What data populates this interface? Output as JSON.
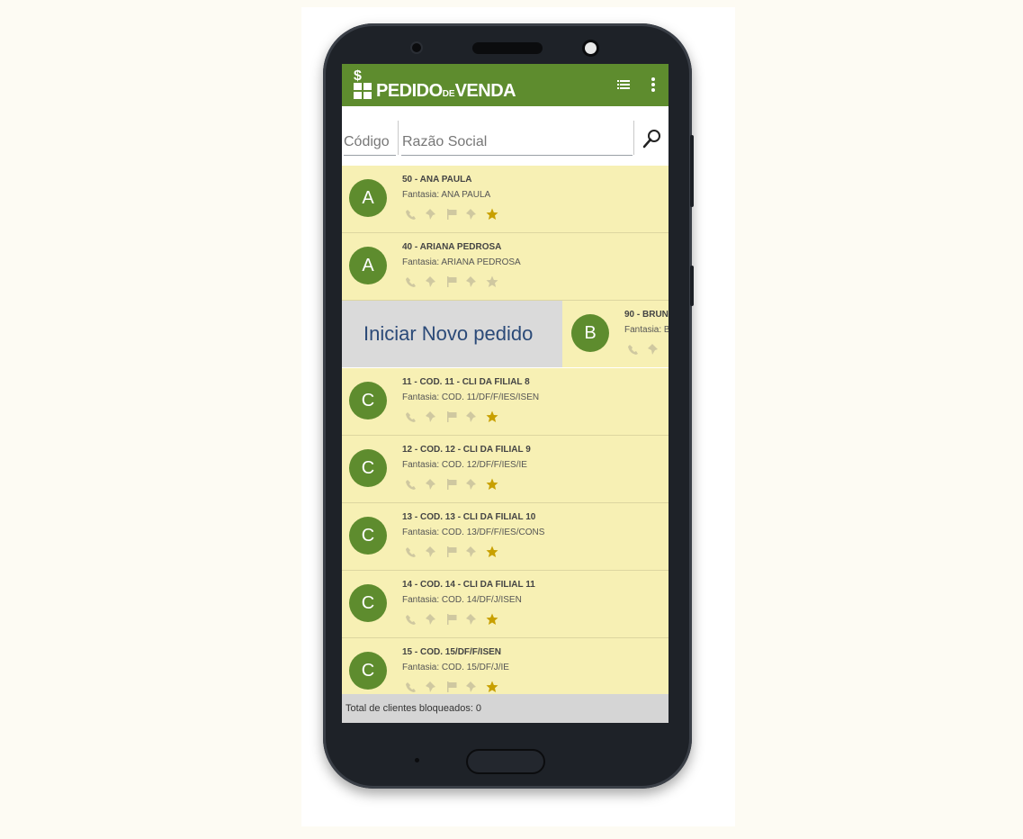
{
  "app": {
    "title_main": "PEDIDO",
    "title_small": "DE",
    "title_end": "VENDA",
    "colors": {
      "primary": "#5e8c2e",
      "row_bg": "#f7f0b4",
      "swipe_bg": "#dadada",
      "swipe_text": "#2b4a78",
      "star_active": "#c8a000"
    }
  },
  "toolbar": {
    "icons": [
      "list-icon",
      "more-vert-icon"
    ]
  },
  "search": {
    "code_placeholder": "Código",
    "name_placeholder": "Razão Social",
    "button_icon": "search-icon"
  },
  "clients": [
    {
      "letter": "A",
      "title": "50 - ANA PAULA",
      "fantasia": "Fantasia: ANA PAULA",
      "star_active": true
    },
    {
      "letter": "A",
      "title": "40 - ARIANA PEDROSA",
      "fantasia": "Fantasia: ARIANA PEDROSA",
      "star_active": false
    },
    {
      "letter": "B",
      "title": "90 - BRUN",
      "fantasia": "Fantasia: B",
      "star_active": false
    },
    {
      "letter": "C",
      "title": "11 - COD. 11 - CLI DA FILIAL 8",
      "fantasia": "Fantasia: COD. 11/DF/F/IES/ISEN",
      "star_active": true
    },
    {
      "letter": "C",
      "title": "12 - COD. 12 - CLI DA FILIAL 9",
      "fantasia": "Fantasia: COD. 12/DF/F/IES/IE",
      "star_active": true
    },
    {
      "letter": "C",
      "title": "13 - COD. 13 - CLI DA FILIAL 10",
      "fantasia": "Fantasia: COD. 13/DF/F/IES/CONS",
      "star_active": true
    },
    {
      "letter": "C",
      "title": "14 - COD. 14 - CLI DA FILIAL 11",
      "fantasia": "Fantasia: COD. 14/DF/J/ISEN",
      "star_active": true
    },
    {
      "letter": "C",
      "title": "15 - COD. 15/DF/F/ISEN",
      "fantasia": "Fantasia: COD. 15/DF/J/IE",
      "star_active": true
    }
  ],
  "swipe_action": {
    "label": "Iniciar Novo pedido"
  },
  "footer": {
    "text": "Total de clientes bloqueados: 0"
  }
}
